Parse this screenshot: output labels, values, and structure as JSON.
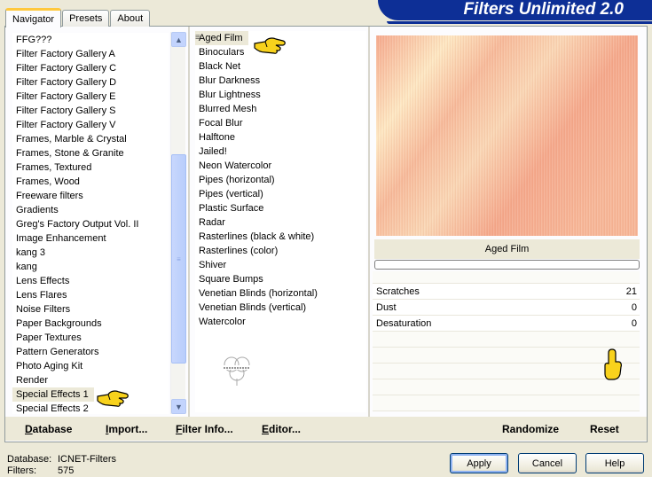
{
  "header": {
    "title": "Filters Unlimited 2.0"
  },
  "tabs": [
    {
      "label": "Navigator",
      "active": true
    },
    {
      "label": "Presets",
      "active": false
    },
    {
      "label": "About",
      "active": false
    }
  ],
  "categories": {
    "items": [
      "FFG???",
      "Filter Factory Gallery A",
      "Filter Factory Gallery C",
      "Filter Factory Gallery D",
      "Filter Factory Gallery E",
      "Filter Factory Gallery S",
      "Filter Factory Gallery V",
      "Frames, Marble & Crystal",
      "Frames, Stone & Granite",
      "Frames, Textured",
      "Frames, Wood",
      "Freeware filters",
      "Gradients",
      "Greg's Factory Output Vol. II",
      "Image Enhancement",
      "kang 3",
      "kang",
      "Lens Effects",
      "Lens Flares",
      "Noise Filters",
      "Paper Backgrounds",
      "Paper Textures",
      "Pattern Generators",
      "Photo Aging Kit",
      "Render",
      "Special Effects 1",
      "Special Effects 2"
    ],
    "selected": "Special Effects 1"
  },
  "filters": {
    "items": [
      "Aged Film",
      "Binoculars",
      "Black Net",
      "Blur Darkness",
      "Blur Lightness",
      "Blurred Mesh",
      "Focal Blur",
      "Halftone",
      "Jailed!",
      "Neon Watercolor",
      "Pipes (horizontal)",
      "Pipes (vertical)",
      "Plastic Surface",
      "Radar",
      "Rasterlines (black & white)",
      "Rasterlines (color)",
      "Shiver",
      "Square Bumps",
      "Venetian Blinds (horizontal)",
      "Venetian Blinds (vertical)",
      "Watercolor"
    ],
    "selected": "Aged Film"
  },
  "preview": {
    "filter_name": "Aged Film",
    "progress": 0
  },
  "params": [
    {
      "label": "Scratches",
      "value": "21"
    },
    {
      "label": "Dust",
      "value": "0"
    },
    {
      "label": "Desaturation",
      "value": "0"
    }
  ],
  "bottom": {
    "database": "Database",
    "import": "Import...",
    "filter_info": "Filter Info...",
    "editor": "Editor...",
    "randomize": "Randomize",
    "reset": "Reset"
  },
  "status": {
    "database_label": "Database:",
    "database_value": "ICNET-Filters",
    "filters_label": "Filters:",
    "filters_value": "575"
  },
  "buttons": {
    "apply": "Apply",
    "cancel": "Cancel",
    "help": "Help"
  },
  "colors": {
    "accent": "#0d2f96",
    "tab_highlight": "#ffc83c",
    "preview": "#f7bfa5"
  }
}
